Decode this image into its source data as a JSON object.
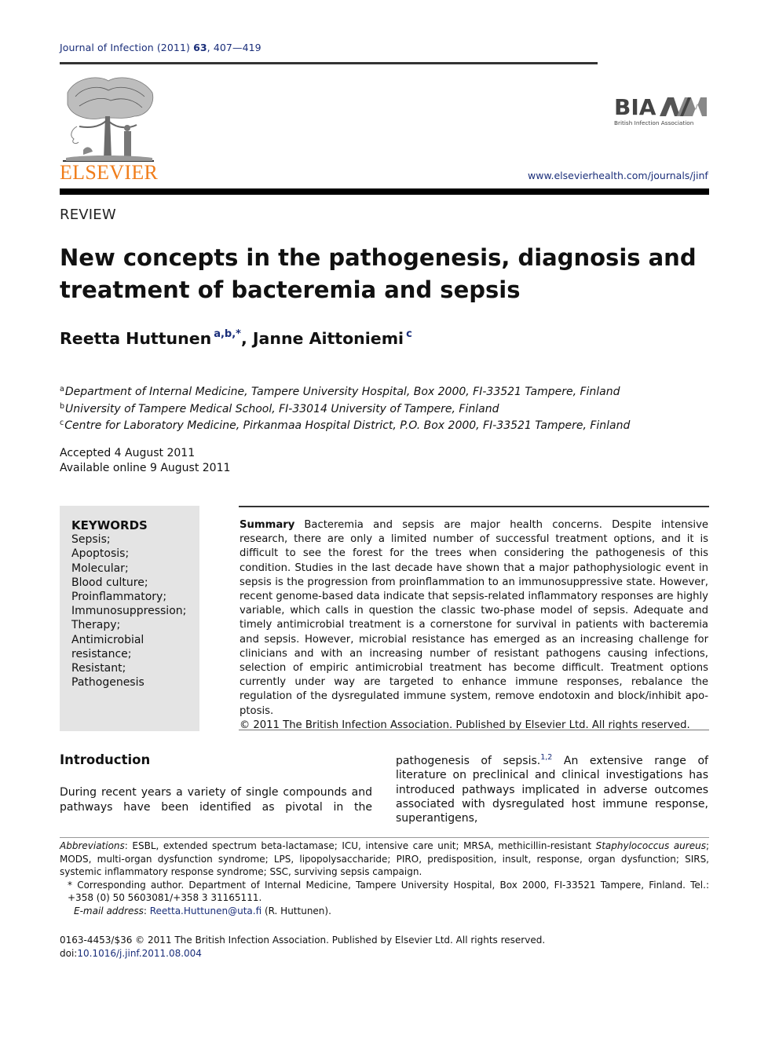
{
  "header": {
    "journal_name": "Journal of Infection (2011) ",
    "volume": "63",
    "pages": ", 407—419",
    "publisher_logo_text": "ELSEVIER",
    "society_logo_text": "BIA",
    "society_name": "British Infection Association",
    "journal_url": "www.elsevierhealth.com/journals/jinf"
  },
  "article": {
    "type": "REVIEW",
    "title_line1": "New concepts in the pathogenesis, diagnosis and",
    "title_line2": "treatment of bacteremia and sepsis",
    "authors": [
      {
        "name": "Reetta Huttunen",
        "marks": "a,b,*"
      },
      {
        "name": "Janne Aittoniemi",
        "marks": "c"
      }
    ],
    "author_separator": ", ",
    "affiliations": [
      {
        "mark": "a",
        "text": "Department of Internal Medicine, Tampere University Hospital, Box 2000, FI-33521 Tampere, Finland"
      },
      {
        "mark": "b",
        "text": "University of Tampere Medical School, FI-33014 University of Tampere, Finland"
      },
      {
        "mark": "c",
        "text": "Centre for Laboratory Medicine, Pirkanmaa Hospital District, P.O. Box 2000, FI-33521 Tampere, Finland"
      }
    ],
    "accepted": "Accepted 4 August 2011",
    "available_online": "Available online 9 August 2011"
  },
  "keywords": {
    "title": "KEYWORDS",
    "items": [
      "Sepsis;",
      "Apoptosis;",
      "Molecular;",
      "Blood culture;",
      "Proinflammatory;",
      "Immunosuppression;",
      "Therapy;",
      "Antimicrobial",
      "resistance;",
      "Resistant;",
      "Pathogenesis"
    ]
  },
  "abstract": {
    "label": "Summary",
    "text": "Bacteremia and sepsis are major health concerns. Despite intensive research, there are only a limited number of successful treatment options, and it is difficult to see the forest for the trees when considering the pathogenesis of this condition. Studies in the last decade have shown that a major pathophysiologic event in sepsis is the progression from proin­flammation to an immunosuppressive state. However, recent genome-based data indicate that sepsis-related inflammatory responses are highly variable, which calls in question the classic two-phase model of sepsis. Adequate and timely antimicrobial treatment is a cornerstone for survival in patients with bacteremia and sepsis. However, microbial resistance has emerged as an increasing challenge for clinicians and with an increasing number of resistant pathogens causing infections, selection of empiric antimicrobial treatment has become difficult. Treat­ment options currently under way are targeted to enhance immune responses, rebalance the regulation of the dysregulated immune system, remove endotoxin and block/inhibit apo­ptosis.",
    "copyright": "© 2011 The British Infection Association. Published by Elsevier Ltd. All rights reserved."
  },
  "introduction": {
    "heading": "Introduction",
    "left_text": "During recent years a variety of single compounds and pathways have been identified as pivotal in the",
    "right_text_before": "pathogenesis of sepsis.",
    "right_refs": "1,2",
    "right_text_after": " An extensive range of literature on preclinical and clinical investigations has introduced pathways implicated in adverse outcomes associated with dysregulated host immune response, superantigens,"
  },
  "footnotes": {
    "abbrev_label": "Abbreviations",
    "abbrev_text_1": ": ESBL, extended spectrum beta-lactamase; ICU, intensive care unit; MRSA, methicillin-resistant ",
    "abbrev_species": "Staphylococcus aureus",
    "abbrev_text_2": "; MODS, multi-organ dysfunction syndrome; LPS, lipopolysaccharide; PIRO, predisposition, insult, response, organ dysfunction; SIRS, systemic inflammatory response syndrome; SSC, surviving sepsis campaign.",
    "corresponding": "* Corresponding author. Department of Internal Medicine, Tampere University Hospital, Box 2000, FI-33521 Tampere, Finland. Tel.: +358 (0) 50 5603081/+358 3 31165111.",
    "email_label": "E-mail address",
    "email": "Reetta.Huttunen@uta.fi",
    "email_suffix": " (R. Huttunen)."
  },
  "bottom": {
    "issn_line": "0163-4453/$36 © 2011 The British Infection Association. Published by Elsevier Ltd. All rights reserved.",
    "doi_label": "doi:",
    "doi": "10.1016/j.jinf.2011.08.004"
  },
  "colors": {
    "link_blue": "#1a2e7a",
    "elsevier_orange": "#f07d1a",
    "keyword_box": "#e4e4e4"
  }
}
